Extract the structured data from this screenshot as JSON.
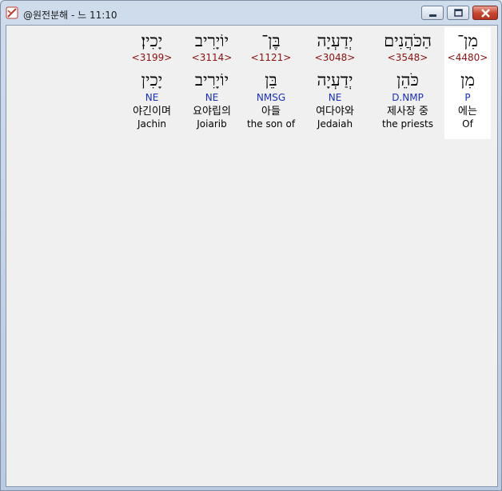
{
  "window": {
    "title": "@원전분해 - 느 11:10"
  },
  "colors": {
    "strong": "#8b1010",
    "morph": "#1a2fbf",
    "highlight": "#ffffff",
    "background": "#f0f0f0"
  },
  "columns": [
    {
      "hebrew": "יָכִין׃",
      "strong": "<3199>",
      "lemma": "יָכִין",
      "morph": "NE",
      "korean": "야긴이며",
      "english": "Jachin"
    },
    {
      "hebrew": "יוֹיָרִיב",
      "strong": "<3114>",
      "lemma": "יוֹיָרִיב",
      "morph": "NE",
      "korean": "요야립의",
      "english": "Joiarib"
    },
    {
      "hebrew": "בֶּן־",
      "strong": "<1121>",
      "lemma": "בֵּן",
      "morph": "NMSG",
      "korean": "아들",
      "english": "the son of"
    },
    {
      "hebrew": "יְדַעְיָה",
      "strong": "<3048>",
      "lemma": "יְדַעְיָה",
      "morph": "NE",
      "korean": "여다야와",
      "english": "Jedaiah"
    },
    {
      "hebrew": "הַכֹּהֲנִים",
      "strong": "<3548>",
      "lemma": "כֹּהֵן",
      "morph": "D.NMP",
      "korean": "제사장 중",
      "english": "the priests"
    },
    {
      "hebrew": "מִן־",
      "strong": "<4480>",
      "lemma": "מִן",
      "morph": "P",
      "korean": "에는",
      "english": "Of"
    }
  ]
}
